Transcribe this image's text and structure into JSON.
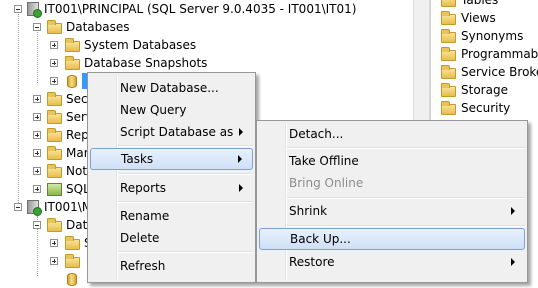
{
  "tree": {
    "server1": "IT001\\PRINCIPAL (SQL Server 9.0.4035 - IT001\\IT01)",
    "databases": "Databases",
    "system_databases": "System Databases",
    "database_snapshots": "Database Snapshots",
    "sec_trunc": "Secu",
    "serv_trunc": "Serv",
    "rep_trunc": "Rep",
    "man_trunc": "Mar",
    "not_trunc": "Not",
    "sql_trunc": "SQL",
    "server2": "IT001\\M",
    "data_trunc": "Data",
    "s_trunc": "S"
  },
  "right_pane": {
    "items": [
      "Tables",
      "Views",
      "Synonyms",
      "Programmabilit",
      "Service Broker",
      "Storage",
      "Security"
    ]
  },
  "context_menu": {
    "new_database": "New Database...",
    "new_query": "New Query",
    "script_database_as": "Script Database as",
    "tasks": "Tasks",
    "reports": "Reports",
    "rename": "Rename",
    "delete": "Delete",
    "refresh": "Refresh"
  },
  "tasks_menu": {
    "detach": "Detach...",
    "take_offline": "Take Offline",
    "bring_online": "Bring Online",
    "shrink": "Shrink",
    "back_up": "Back Up...",
    "restore": "Restore"
  }
}
